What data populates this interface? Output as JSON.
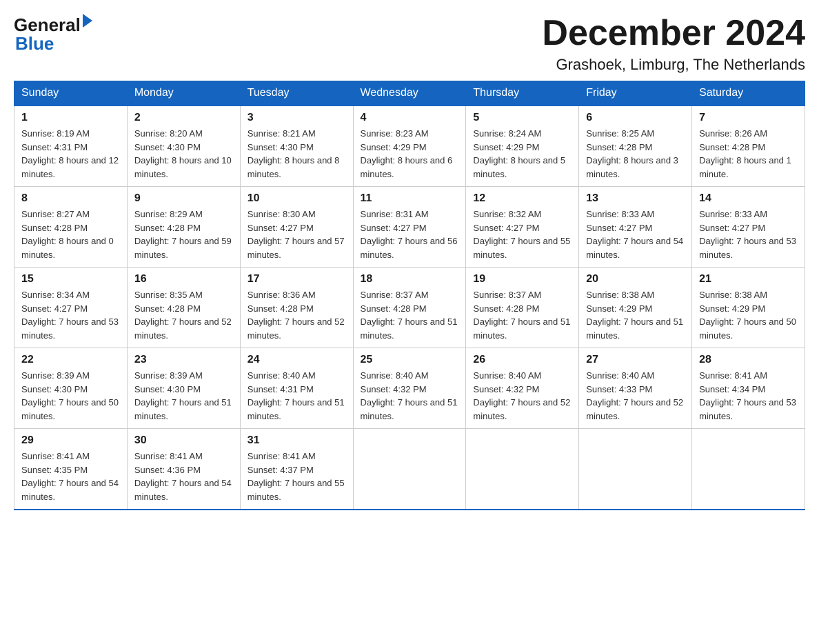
{
  "header": {
    "logo": {
      "text1": "General",
      "text2": "Blue"
    },
    "title": "December 2024",
    "location": "Grashoek, Limburg, The Netherlands"
  },
  "calendar": {
    "days_of_week": [
      "Sunday",
      "Monday",
      "Tuesday",
      "Wednesday",
      "Thursday",
      "Friday",
      "Saturday"
    ],
    "weeks": [
      [
        {
          "day": "1",
          "sunrise": "Sunrise: 8:19 AM",
          "sunset": "Sunset: 4:31 PM",
          "daylight": "Daylight: 8 hours and 12 minutes."
        },
        {
          "day": "2",
          "sunrise": "Sunrise: 8:20 AM",
          "sunset": "Sunset: 4:30 PM",
          "daylight": "Daylight: 8 hours and 10 minutes."
        },
        {
          "day": "3",
          "sunrise": "Sunrise: 8:21 AM",
          "sunset": "Sunset: 4:30 PM",
          "daylight": "Daylight: 8 hours and 8 minutes."
        },
        {
          "day": "4",
          "sunrise": "Sunrise: 8:23 AM",
          "sunset": "Sunset: 4:29 PM",
          "daylight": "Daylight: 8 hours and 6 minutes."
        },
        {
          "day": "5",
          "sunrise": "Sunrise: 8:24 AM",
          "sunset": "Sunset: 4:29 PM",
          "daylight": "Daylight: 8 hours and 5 minutes."
        },
        {
          "day": "6",
          "sunrise": "Sunrise: 8:25 AM",
          "sunset": "Sunset: 4:28 PM",
          "daylight": "Daylight: 8 hours and 3 minutes."
        },
        {
          "day": "7",
          "sunrise": "Sunrise: 8:26 AM",
          "sunset": "Sunset: 4:28 PM",
          "daylight": "Daylight: 8 hours and 1 minute."
        }
      ],
      [
        {
          "day": "8",
          "sunrise": "Sunrise: 8:27 AM",
          "sunset": "Sunset: 4:28 PM",
          "daylight": "Daylight: 8 hours and 0 minutes."
        },
        {
          "day": "9",
          "sunrise": "Sunrise: 8:29 AM",
          "sunset": "Sunset: 4:28 PM",
          "daylight": "Daylight: 7 hours and 59 minutes."
        },
        {
          "day": "10",
          "sunrise": "Sunrise: 8:30 AM",
          "sunset": "Sunset: 4:27 PM",
          "daylight": "Daylight: 7 hours and 57 minutes."
        },
        {
          "day": "11",
          "sunrise": "Sunrise: 8:31 AM",
          "sunset": "Sunset: 4:27 PM",
          "daylight": "Daylight: 7 hours and 56 minutes."
        },
        {
          "day": "12",
          "sunrise": "Sunrise: 8:32 AM",
          "sunset": "Sunset: 4:27 PM",
          "daylight": "Daylight: 7 hours and 55 minutes."
        },
        {
          "day": "13",
          "sunrise": "Sunrise: 8:33 AM",
          "sunset": "Sunset: 4:27 PM",
          "daylight": "Daylight: 7 hours and 54 minutes."
        },
        {
          "day": "14",
          "sunrise": "Sunrise: 8:33 AM",
          "sunset": "Sunset: 4:27 PM",
          "daylight": "Daylight: 7 hours and 53 minutes."
        }
      ],
      [
        {
          "day": "15",
          "sunrise": "Sunrise: 8:34 AM",
          "sunset": "Sunset: 4:27 PM",
          "daylight": "Daylight: 7 hours and 53 minutes."
        },
        {
          "day": "16",
          "sunrise": "Sunrise: 8:35 AM",
          "sunset": "Sunset: 4:28 PM",
          "daylight": "Daylight: 7 hours and 52 minutes."
        },
        {
          "day": "17",
          "sunrise": "Sunrise: 8:36 AM",
          "sunset": "Sunset: 4:28 PM",
          "daylight": "Daylight: 7 hours and 52 minutes."
        },
        {
          "day": "18",
          "sunrise": "Sunrise: 8:37 AM",
          "sunset": "Sunset: 4:28 PM",
          "daylight": "Daylight: 7 hours and 51 minutes."
        },
        {
          "day": "19",
          "sunrise": "Sunrise: 8:37 AM",
          "sunset": "Sunset: 4:28 PM",
          "daylight": "Daylight: 7 hours and 51 minutes."
        },
        {
          "day": "20",
          "sunrise": "Sunrise: 8:38 AM",
          "sunset": "Sunset: 4:29 PM",
          "daylight": "Daylight: 7 hours and 51 minutes."
        },
        {
          "day": "21",
          "sunrise": "Sunrise: 8:38 AM",
          "sunset": "Sunset: 4:29 PM",
          "daylight": "Daylight: 7 hours and 50 minutes."
        }
      ],
      [
        {
          "day": "22",
          "sunrise": "Sunrise: 8:39 AM",
          "sunset": "Sunset: 4:30 PM",
          "daylight": "Daylight: 7 hours and 50 minutes."
        },
        {
          "day": "23",
          "sunrise": "Sunrise: 8:39 AM",
          "sunset": "Sunset: 4:30 PM",
          "daylight": "Daylight: 7 hours and 51 minutes."
        },
        {
          "day": "24",
          "sunrise": "Sunrise: 8:40 AM",
          "sunset": "Sunset: 4:31 PM",
          "daylight": "Daylight: 7 hours and 51 minutes."
        },
        {
          "day": "25",
          "sunrise": "Sunrise: 8:40 AM",
          "sunset": "Sunset: 4:32 PM",
          "daylight": "Daylight: 7 hours and 51 minutes."
        },
        {
          "day": "26",
          "sunrise": "Sunrise: 8:40 AM",
          "sunset": "Sunset: 4:32 PM",
          "daylight": "Daylight: 7 hours and 52 minutes."
        },
        {
          "day": "27",
          "sunrise": "Sunrise: 8:40 AM",
          "sunset": "Sunset: 4:33 PM",
          "daylight": "Daylight: 7 hours and 52 minutes."
        },
        {
          "day": "28",
          "sunrise": "Sunrise: 8:41 AM",
          "sunset": "Sunset: 4:34 PM",
          "daylight": "Daylight: 7 hours and 53 minutes."
        }
      ],
      [
        {
          "day": "29",
          "sunrise": "Sunrise: 8:41 AM",
          "sunset": "Sunset: 4:35 PM",
          "daylight": "Daylight: 7 hours and 54 minutes."
        },
        {
          "day": "30",
          "sunrise": "Sunrise: 8:41 AM",
          "sunset": "Sunset: 4:36 PM",
          "daylight": "Daylight: 7 hours and 54 minutes."
        },
        {
          "day": "31",
          "sunrise": "Sunrise: 8:41 AM",
          "sunset": "Sunset: 4:37 PM",
          "daylight": "Daylight: 7 hours and 55 minutes."
        },
        null,
        null,
        null,
        null
      ]
    ]
  }
}
